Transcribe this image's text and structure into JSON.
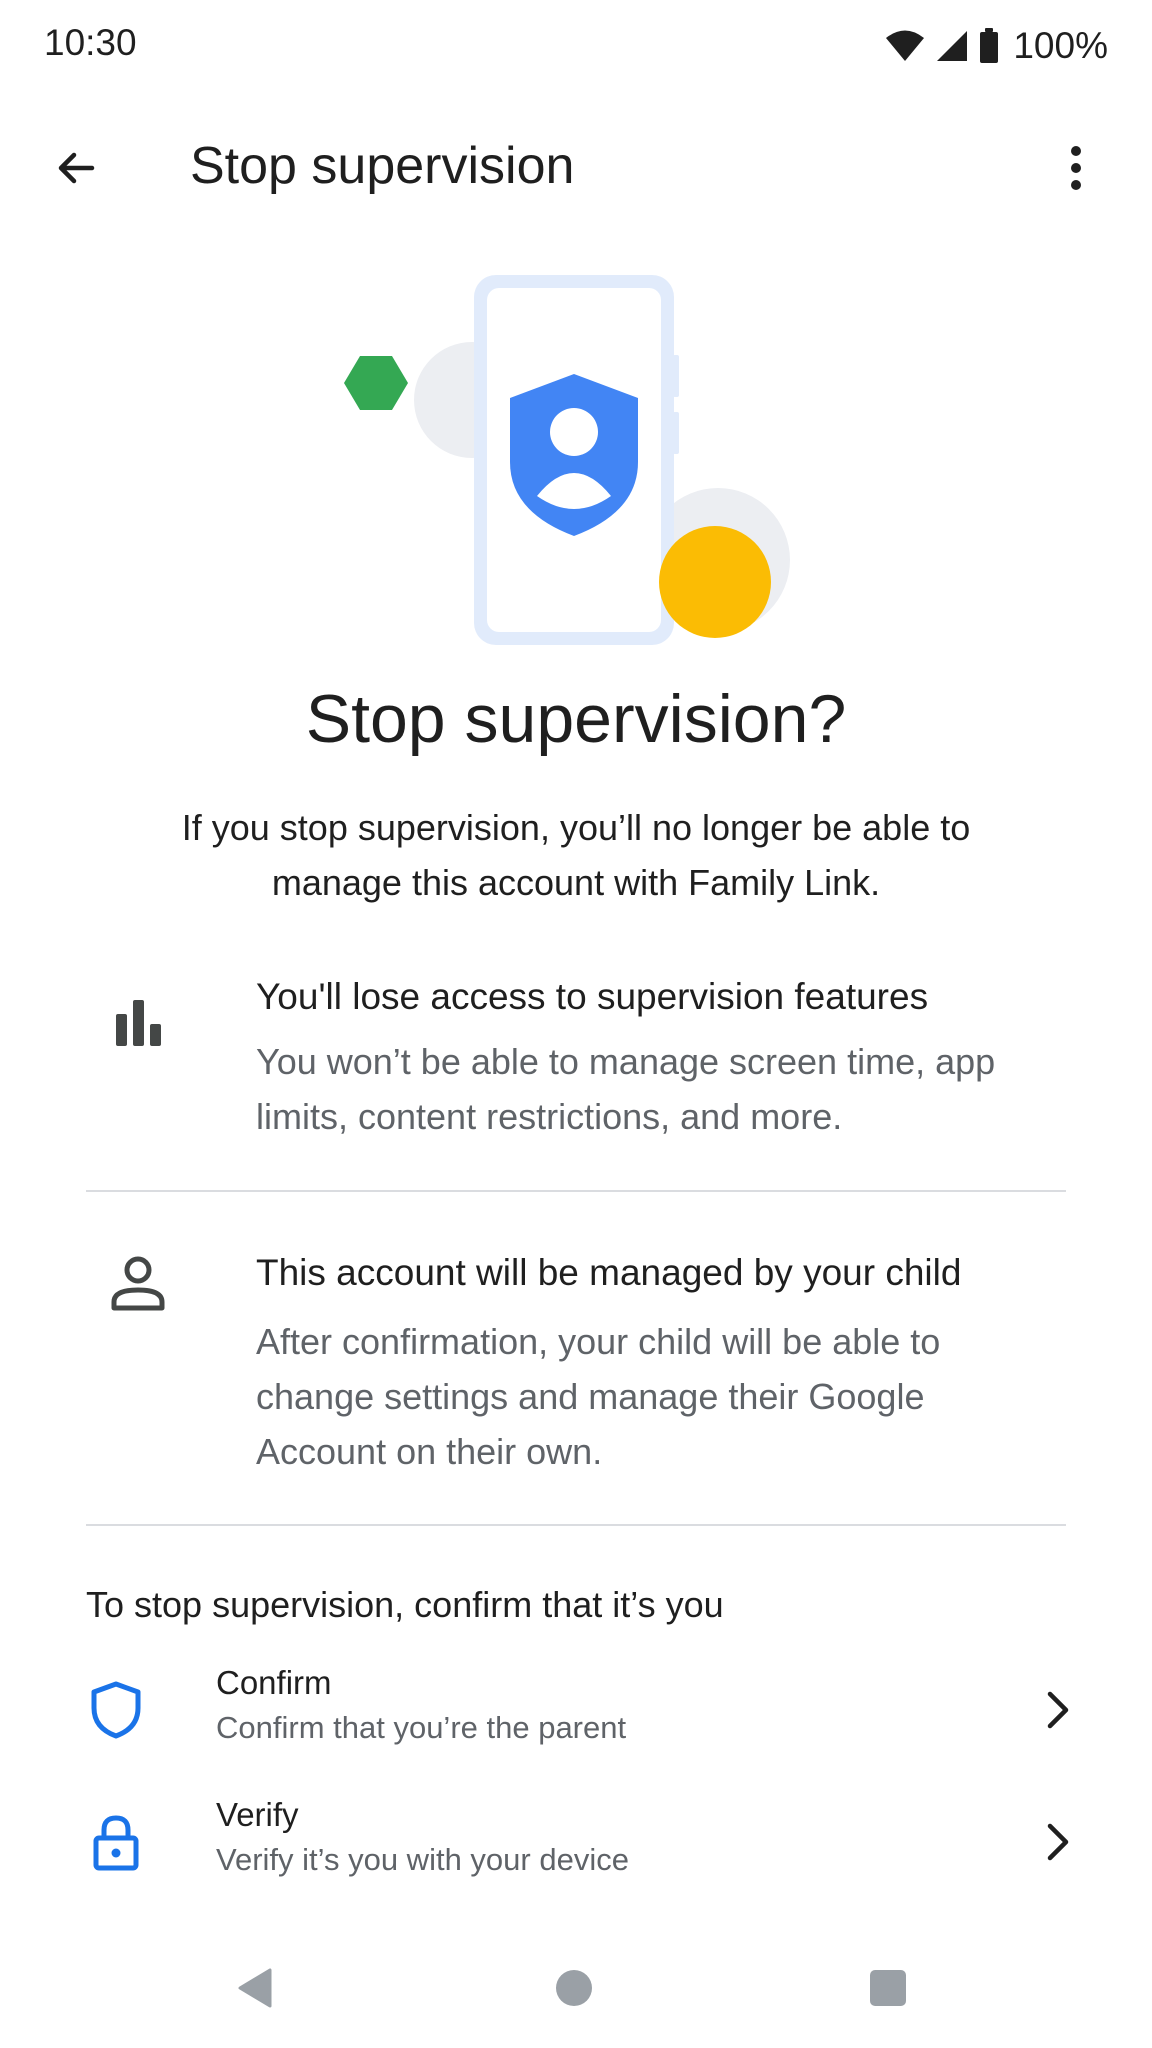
{
  "status_bar": {
    "time": "10:30",
    "battery": "100%",
    "icons": [
      "wifi-icon",
      "signal-icon",
      "battery-icon"
    ]
  },
  "app_bar": {
    "title": "Stop supervision",
    "back_icon": "arrow-back-icon",
    "more_icon": "more-vert-icon"
  },
  "content": {
    "headline": "Stop supervision?",
    "intro": "If you stop supervision, you’ll no longer be able to manage this account with Family Link.",
    "info_items": [
      {
        "icon": "bar-chart-icon",
        "title": "You'll lose access to supervision features",
        "description": "You won’t be able to manage screen time, app limits, content restrictions, and more."
      },
      {
        "icon": "person-icon",
        "title": "This account will be managed by your child",
        "description": "After confirmation, your child will be able to change settings and manage their Google Account on their own."
      }
    ],
    "confirm_prompt": "To stop supervision, confirm that it’s you",
    "options": [
      {
        "icon": "shield-icon",
        "title": "Confirm",
        "subtitle": "Confirm that you’re the parent"
      },
      {
        "icon": "lock-icon",
        "title": "Verify",
        "subtitle": "Verify it’s you with your device"
      }
    ]
  },
  "nav_bar": {
    "buttons": [
      "nav-back-icon",
      "nav-home-icon",
      "nav-recents-icon"
    ]
  },
  "colors": {
    "accent_blue": "#1a73e8",
    "illustration_blue": "#4285f4",
    "green": "#34a853",
    "yellow": "#fbbc04",
    "text_primary": "#1f1f1f",
    "text_secondary": "#5f6368",
    "divider": "#dadce0"
  }
}
